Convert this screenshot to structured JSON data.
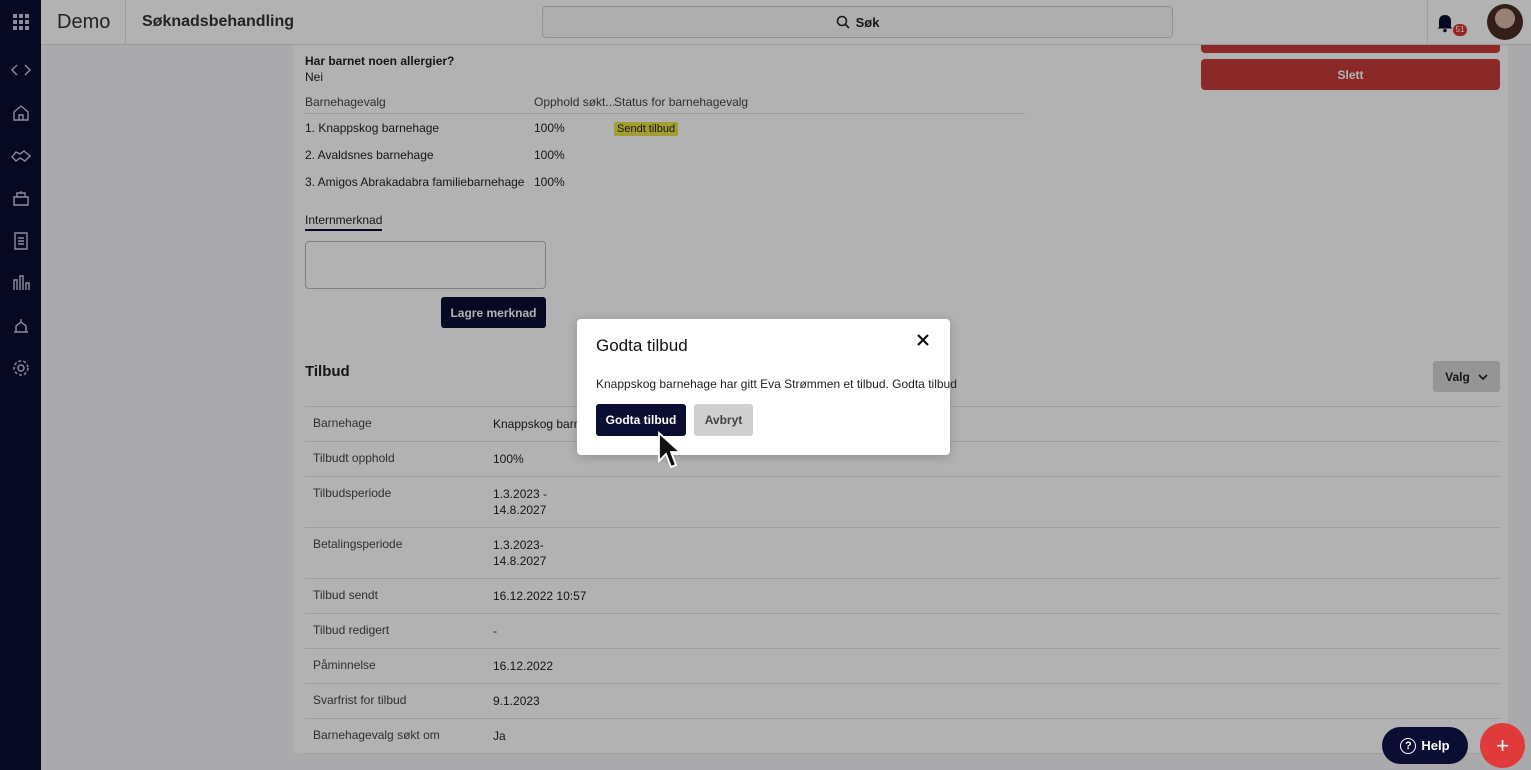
{
  "app": {
    "brand": "Demo",
    "page_title": "Søknadsbehandling",
    "search_label": "Søk",
    "notification_count": "51"
  },
  "nav": {
    "icons": [
      "apps-grid-icon",
      "code-icon",
      "home-icon",
      "handshake-icon",
      "school-icon",
      "document-icon",
      "bar-chart-icon",
      "tools-icon",
      "gear-icon"
    ]
  },
  "application": {
    "allergy_question": "Har barnet noen allergier?",
    "allergy_answer": "Nei",
    "choices_headers": [
      "Barnehagevalg",
      "Opphold søkt...",
      "Status for barnehagevalg"
    ],
    "choices": [
      {
        "name": "1. Knappskog barnehage",
        "stay": "100%",
        "status": "Sendt tilbud"
      },
      {
        "name": "2. Avaldsnes barnehage",
        "stay": "100%",
        "status": ""
      },
      {
        "name": "3. Amigos Abrakadabra familiebarnehage",
        "stay": "100%",
        "status": ""
      }
    ],
    "internal_note_tab": "Internmerknad",
    "save_note_label": "Lagre merknad",
    "delete_label": "Slett"
  },
  "offer": {
    "title": "Tilbud",
    "options_label": "Valg",
    "rows": [
      {
        "key": "Barnehage",
        "value": "Knappskog barnehage"
      },
      {
        "key": "Tilbudt opphold",
        "value": "100%"
      },
      {
        "key": "Tilbudsperiode",
        "value": "1.3.2023 -\n14.8.2027"
      },
      {
        "key": "Betalingsperiode",
        "value": "1.3.2023-\n14.8.2027"
      },
      {
        "key": "Tilbud sendt",
        "value": "16.12.2022 10:57"
      },
      {
        "key": "Tilbud redigert",
        "value": "-"
      },
      {
        "key": "Påminnelse",
        "value": "16.12.2022"
      },
      {
        "key": "Svarfrist for tilbud",
        "value": "9.1.2023"
      },
      {
        "key": "Barnehagevalg søkt om",
        "value": "Ja"
      }
    ]
  },
  "modal": {
    "title": "Godta tilbud",
    "message": "Knappskog barnehage har gitt Eva Strømmen et tilbud. Godta tilbud",
    "accept_label": "Godta tilbud",
    "cancel_label": "Avbryt"
  },
  "floating": {
    "help_label": "Help"
  },
  "colors": {
    "nav_bg": "#0b0e33",
    "primary": "#0b0e33",
    "danger": "#c73a3a",
    "status_tag": "#e8e34a",
    "fab": "#e03a3a"
  }
}
